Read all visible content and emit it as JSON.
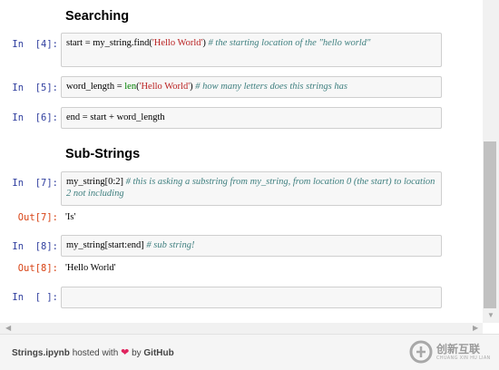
{
  "notebook": {
    "section_searching": "Searching",
    "section_substrings": "Sub-Strings",
    "cells": [
      {
        "prompt": "In  [4]:",
        "code_prefix": "start = my_string.find(",
        "code_string": "'Hello World'",
        "code_suffix": ") ",
        "code_comment": "# the starting location of the \"hello world\""
      },
      {
        "prompt": "In  [5]:",
        "code_prefix": "word_length = ",
        "code_builtin": "len",
        "code_open": "(",
        "code_string": "'Hello World'",
        "code_suffix": ") ",
        "code_comment": "# how many letters does this strings has"
      },
      {
        "prompt": "In  [6]:",
        "code": "end = start + word_length"
      },
      {
        "prompt": "In  [7]:",
        "code_prefix": "my_string[0:2] ",
        "code_comment": "# this is asking a substring from my_string, from location 0 (the start) to location 2 not including",
        "out_prompt": "Out[7]:",
        "output": "'Is'"
      },
      {
        "prompt": "In  [8]:",
        "code_prefix": "my_string[start:end] ",
        "code_comment": "# sub string!",
        "out_prompt": "Out[8]:",
        "output": "'Hello World'"
      },
      {
        "prompt": "In  [ ]:",
        "code": ""
      }
    ]
  },
  "footer": {
    "filename": "Strings.ipynb",
    "hosted_text": "hosted with",
    "by_text": "by",
    "github": "GitHub"
  },
  "watermark": {
    "cn_text": "创新互联",
    "en_text": "CHUANG XIN HU LIAN"
  },
  "colors": {
    "in_prompt": "#303f9f",
    "out_prompt": "#d84315",
    "string": "#ba2121",
    "comment": "#408080",
    "builtin": "#008000"
  }
}
